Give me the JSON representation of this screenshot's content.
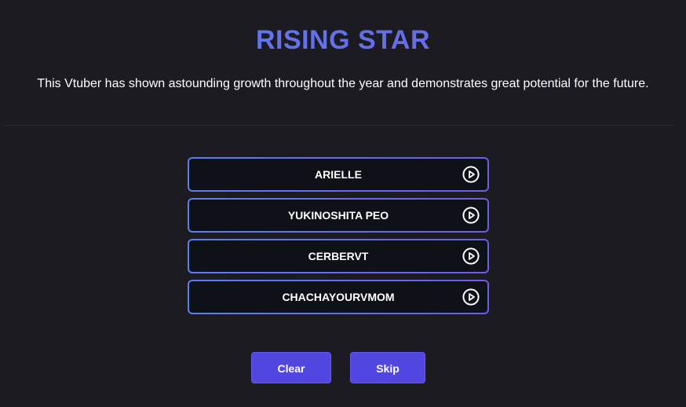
{
  "header": {
    "title": "RISING STAR",
    "description": "This Vtuber has shown astounding growth throughout the year and demonstrates great potential for the future."
  },
  "options": [
    {
      "label": "ARIELLE",
      "icon": "play-circle-icon"
    },
    {
      "label": "YUKINOSHITA PEO",
      "icon": "play-circle-icon"
    },
    {
      "label": "CERBERVT",
      "icon": "play-circle-icon"
    },
    {
      "label": "CHACHAYOURVMOM",
      "icon": "play-circle-icon"
    }
  ],
  "actions": {
    "clear_label": "Clear",
    "skip_label": "Skip"
  },
  "colors": {
    "background": "#1c1b21",
    "accent_blue": "#5a7ff0",
    "accent_purple": "#6b5ee6",
    "button": "#5246e0",
    "option_bg": "#0e1117"
  }
}
